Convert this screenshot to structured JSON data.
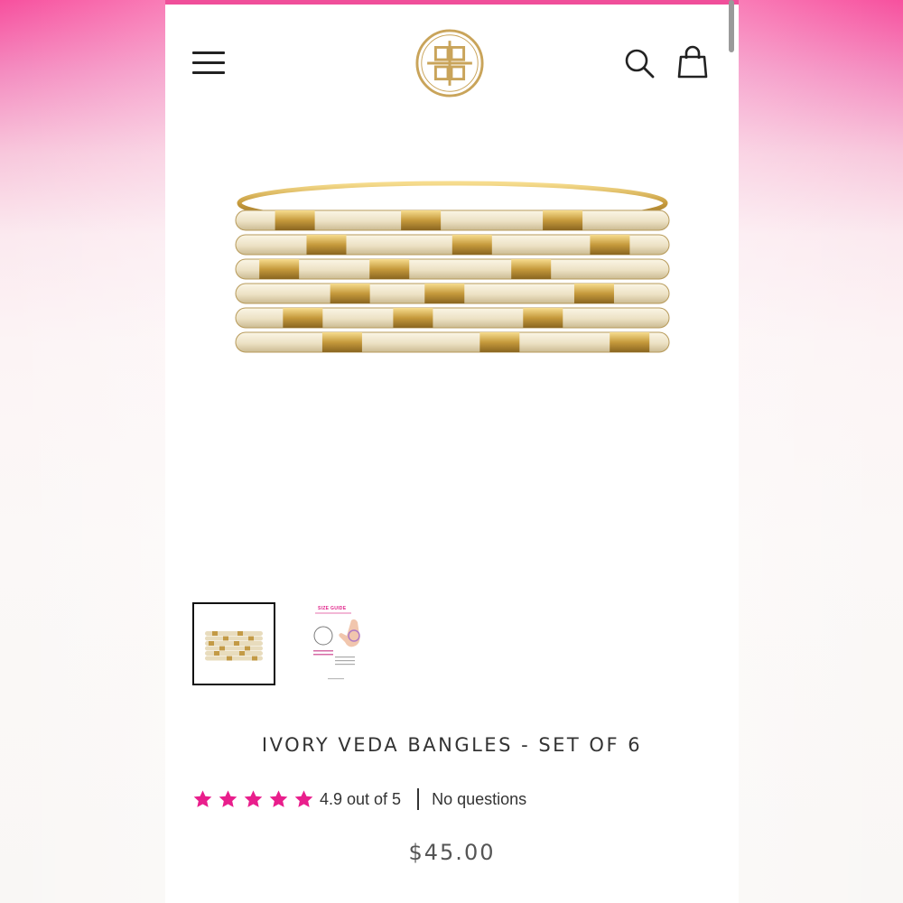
{
  "header": {
    "menu_icon": "hamburger-menu-icon",
    "logo_icon": "brand-monogram-logo",
    "search_icon": "search-icon",
    "cart_icon": "shopping-bag-icon"
  },
  "gallery": {
    "thumbnails": [
      {
        "icon": "bangles-thumbnail",
        "active": true
      },
      {
        "icon": "size-guide-thumbnail",
        "label": "SIZE GUIDE",
        "active": false
      }
    ]
  },
  "product": {
    "title": "IVORY VEDA BANGLES - SET OF 6",
    "rating_text": "4.9 out of 5",
    "rating_value": 4.9,
    "rating_max": 5,
    "questions_text": "No questions",
    "price": "$45.00"
  },
  "colors": {
    "accent_pink": "#f04f9a",
    "star_pink": "#e91e8c",
    "gold": "#c9a45a",
    "ivory": "#efe6cf"
  }
}
